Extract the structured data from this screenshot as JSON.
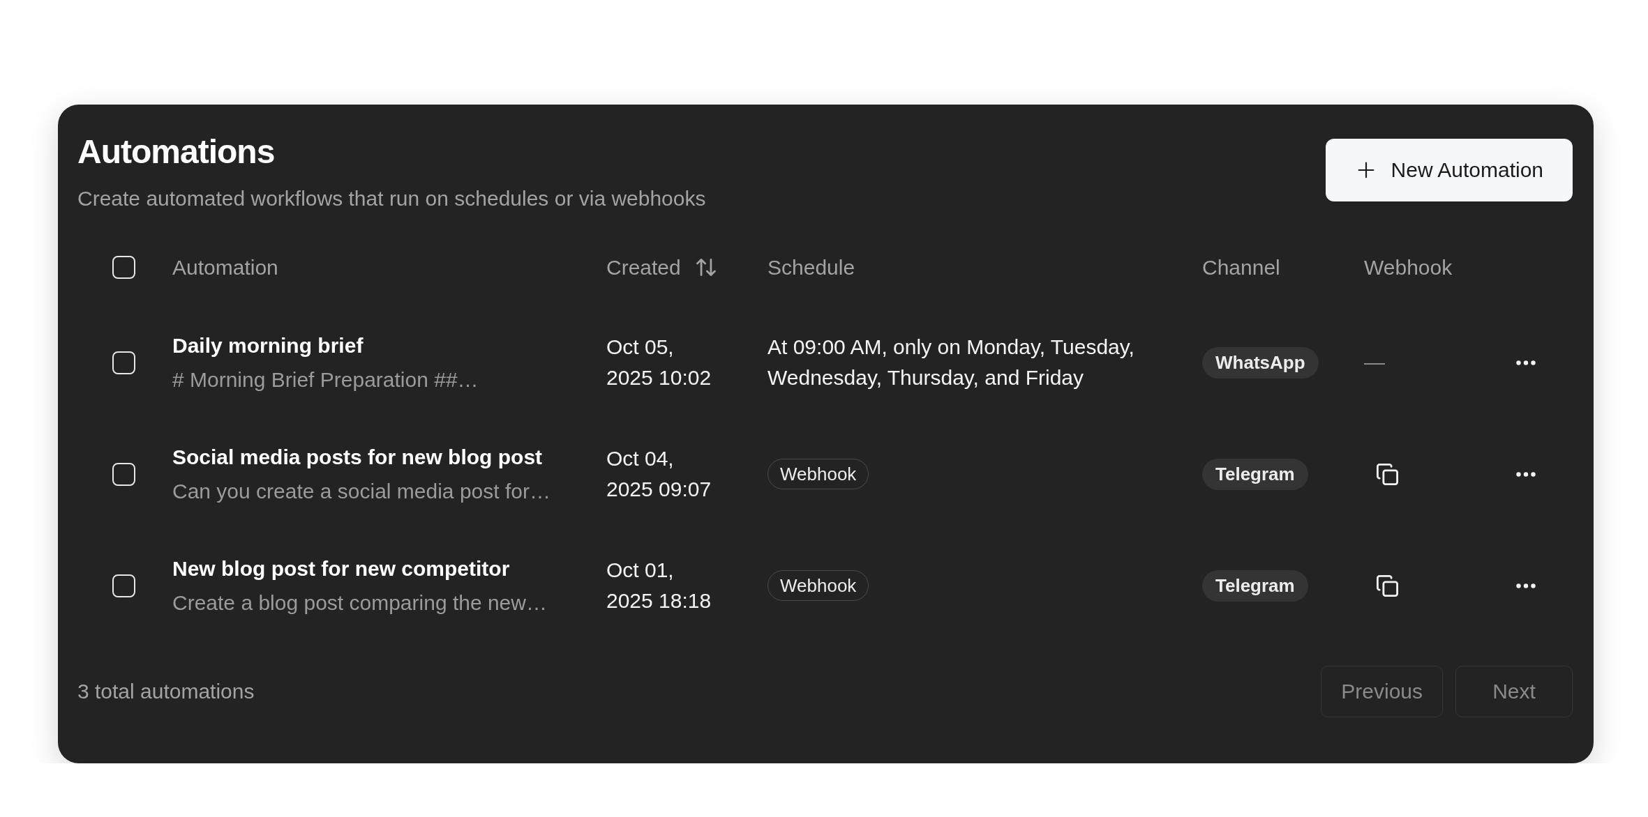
{
  "header": {
    "title": "Automations",
    "subtitle": "Create automated workflows that run on schedules or via webhooks",
    "new_button": {
      "label": "New Automation"
    }
  },
  "table": {
    "select_all": {
      "checked": false
    },
    "columns": [
      {
        "label": "Automation",
        "sortable": false
      },
      {
        "label": "Created",
        "sortable": true
      },
      {
        "label": "Schedule",
        "sortable": false
      },
      {
        "label": "Channel",
        "sortable": false
      },
      {
        "label": "Webhook",
        "sortable": false
      }
    ],
    "rows": [
      {
        "checked": false,
        "name": "Daily morning brief",
        "description": "# Morning Brief Preparation ##…",
        "created": "Oct 05, 2025 10:02",
        "schedule": {
          "kind": "text",
          "text": "At 09:00 AM, only on Monday, Tuesday, Wednesday, Thursday, and Friday"
        },
        "channel": "WhatsApp",
        "webhook": {
          "kind": "dash",
          "text": "—"
        }
      },
      {
        "checked": false,
        "name": "Social media posts for new blog post",
        "description": "Can you create a social media post for…",
        "created": "Oct 04, 2025 09:07",
        "schedule": {
          "kind": "tag",
          "text": "Webhook"
        },
        "channel": "Telegram",
        "webhook": {
          "kind": "copy"
        }
      },
      {
        "checked": false,
        "name": "New blog post for new competitor",
        "description": "Create a blog post comparing the new…",
        "created": "Oct 01, 2025 18:18",
        "schedule": {
          "kind": "tag",
          "text": "Webhook"
        },
        "channel": "Telegram",
        "webhook": {
          "kind": "copy"
        }
      }
    ]
  },
  "footer": {
    "total": "3 total automations",
    "pagination": [
      {
        "label": "Previous",
        "disabled": true
      },
      {
        "label": "Next",
        "disabled": true
      }
    ]
  }
}
